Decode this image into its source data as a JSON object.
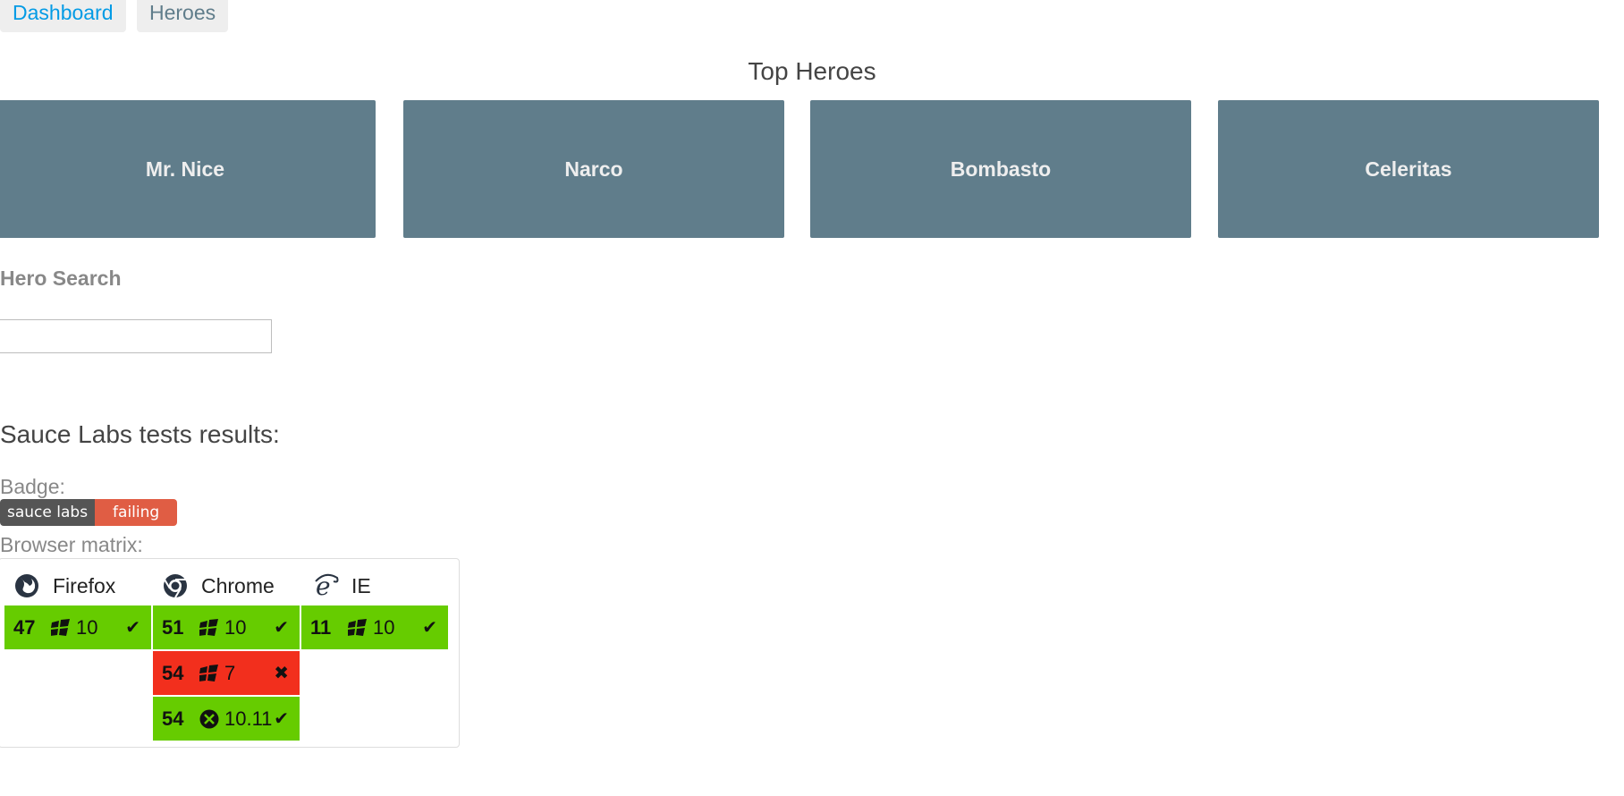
{
  "nav": {
    "dashboard": "Dashboard",
    "heroes": "Heroes"
  },
  "top_heroes_title": "Top Heroes",
  "heroes": [
    "Mr. Nice",
    "Narco",
    "Bombasto",
    "Celeritas"
  ],
  "hero_search": {
    "label": "Hero Search",
    "value": "",
    "placeholder": ""
  },
  "sauce": {
    "title": "Sauce Labs tests results:",
    "badge_label": "Badge:",
    "badge_left": "sauce labs",
    "badge_right": "failing",
    "matrix_label": "Browser matrix:",
    "browsers": [
      {
        "name": "Firefox",
        "icon": "firefox-icon"
      },
      {
        "name": "Chrome",
        "icon": "chrome-icon"
      },
      {
        "name": "IE",
        "icon": "ie-icon"
      }
    ],
    "results": [
      {
        "browser": "Firefox",
        "version": "47",
        "os": "windows-icon",
        "os_version": "10",
        "status": "pass",
        "mark": "✔"
      },
      {
        "browser": "Chrome",
        "version": "51",
        "os": "windows-icon",
        "os_version": "10",
        "status": "pass",
        "mark": "✔"
      },
      {
        "browser": "IE",
        "version": "11",
        "os": "windows-icon",
        "os_version": "10",
        "status": "pass",
        "mark": "✔"
      },
      {
        "browser": "Chrome",
        "version": "54",
        "os": "windows-icon",
        "os_version": "7",
        "status": "fail",
        "mark": "✖"
      },
      {
        "browser": "Chrome",
        "version": "54",
        "os": "osx-icon",
        "os_version": "10.11",
        "status": "pass",
        "mark": "✔"
      }
    ]
  },
  "colors": {
    "hero_card": "#607d8b",
    "nav_active": "#039be5",
    "pass": "#66cc00",
    "fail": "#f22f1d",
    "badge_left": "#555555",
    "badge_right": "#e05d44"
  }
}
